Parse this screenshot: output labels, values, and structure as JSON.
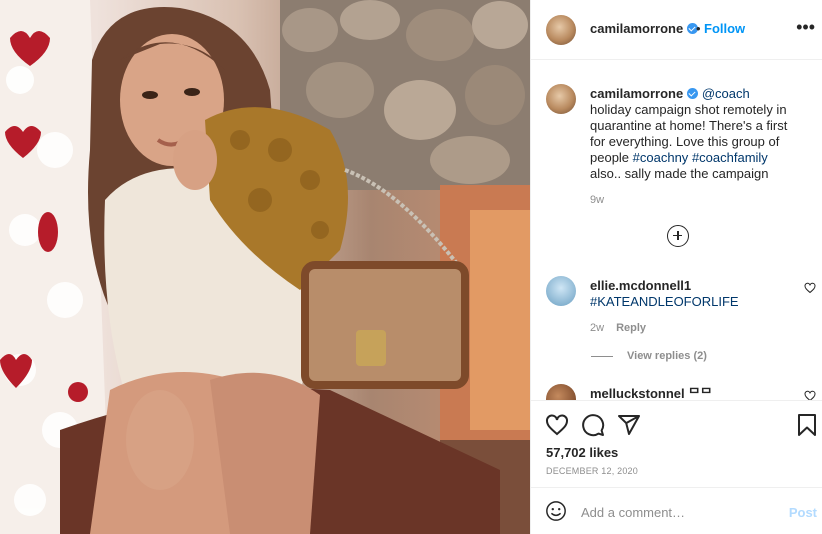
{
  "post": {
    "author": "camilamorrone",
    "follow_dot": "•",
    "follow_label": "Follow",
    "more_label": "•••"
  },
  "caption": {
    "author": "camilamorrone",
    "mention": "@coach",
    "text_1": " holiday campaign shot remotely in quarantine at home! There's a first for everything. Love this group of people ",
    "hashtag_1": "#coachny",
    "hashtag_2": "#coachfamily",
    "text_2": " also.. sally made the campaign",
    "age": "9w"
  },
  "comments": [
    {
      "author": "ellie.mcdonnell1",
      "text": "#KATEANDLEOFORLIFE",
      "age": "2w",
      "reply_label": "Reply",
      "view_replies": "View replies (2)"
    },
    {
      "author": "melluckstonnel ᄆᄆ"
    }
  ],
  "actions": {
    "likes": "57,702 likes",
    "date": "DECEMBER 12, 2020"
  },
  "add_comment": {
    "placeholder": "Add a comment…",
    "post_label": "Post"
  },
  "icons": {
    "like": "heart-icon",
    "comment": "comment-icon",
    "share": "share-icon",
    "save": "bookmark-icon",
    "emoji": "emoji-icon",
    "more": "more-options-icon",
    "load_more": "plus-circle-icon"
  },
  "colors": {
    "link": "#00376b",
    "follow": "#0095f6",
    "muted": "#8e8e8e",
    "verified": "#3897f0"
  }
}
